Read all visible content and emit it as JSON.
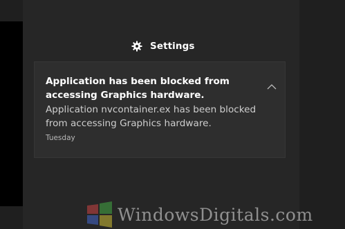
{
  "header": {
    "settings_label": "Settings",
    "settings_icon": "gear-icon"
  },
  "notification": {
    "title": "Application has been blocked from accessing Graphics hardware.",
    "body": "Application nvcontainer.ex has been blocked from accessing Graphics hardware.",
    "time": "Tuesday",
    "collapse_icon": "chevron-up-icon"
  },
  "watermark": {
    "text": "WindowsDigitals.com",
    "logo_icon": "windows-logo-icon"
  },
  "colors": {
    "background": "#1f1f1f",
    "panel": "#262626",
    "toast": "#2e2e2e",
    "text_primary": "#ffffff",
    "text_secondary": "#cfcfcf"
  }
}
